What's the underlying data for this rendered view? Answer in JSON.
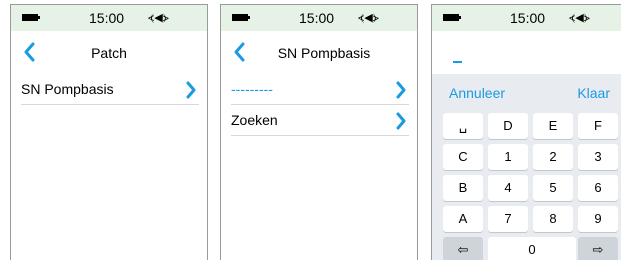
{
  "status": {
    "time": "15:00",
    "vibrate_glyph": "⦓◀⦔",
    "battery_icon": "battery-icon"
  },
  "screen1": {
    "title": "Patch",
    "rows": [
      {
        "label": "SN Pompbasis"
      }
    ]
  },
  "screen2": {
    "title": "SN Pompbasis",
    "rows": [
      {
        "label": "---------",
        "color": "#1a9ae0"
      },
      {
        "label": "Zoeken"
      }
    ]
  },
  "screen3": {
    "input_value": "",
    "cancel_label": "Annuleer",
    "done_label": "Klaar",
    "keys": [
      [
        "␣",
        "D",
        "E",
        "F"
      ],
      [
        "C",
        "1",
        "2",
        "3"
      ],
      [
        "B",
        "4",
        "5",
        "6"
      ],
      [
        "A",
        "7",
        "8",
        "9"
      ]
    ],
    "bottom_row": {
      "left": "⇦",
      "zero": "0",
      "right": "⇨"
    }
  },
  "colors": {
    "accent": "#1a9ae0",
    "statusbar": "#e6f2e6",
    "keyboard": "#e8ecf1"
  }
}
